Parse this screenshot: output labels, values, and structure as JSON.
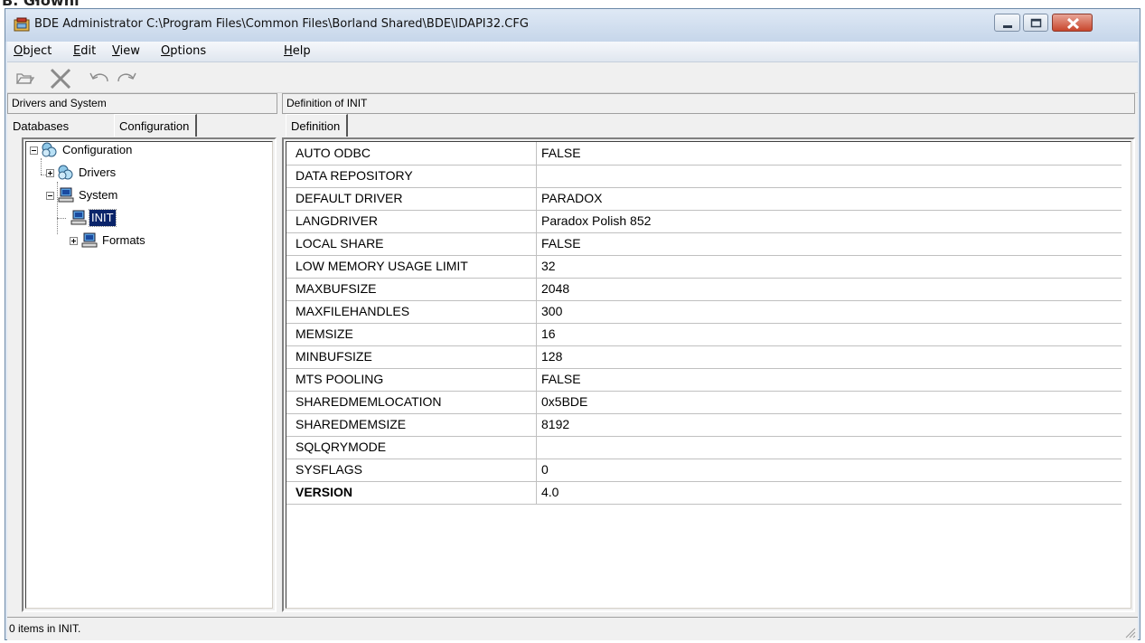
{
  "window": {
    "title": "BDE Administrator  C:\\Program Files\\Common Files\\Borland Shared\\BDE\\IDAPI32.CFG",
    "colors": {
      "titlebar": "#c6d6ea",
      "selection": "#0a246a",
      "close_button": "#c8462c"
    }
  },
  "menu": [
    "Object",
    "Edit",
    "View",
    "Options",
    "Help"
  ],
  "toolbar": {
    "buttons": [
      "open-icon",
      "delete-icon",
      "undo-icon",
      "redo-icon"
    ]
  },
  "left_header": "Drivers and System",
  "right_header": "Definition of INIT",
  "left_tabs": [
    "Databases",
    "Configuration"
  ],
  "right_tabs": [
    "Definition"
  ],
  "tree": [
    {
      "label": "Configuration",
      "icon": "database-cluster-icon",
      "expanded": true
    },
    {
      "label": "Drivers",
      "icon": "database-cluster-icon",
      "expanded": false
    },
    {
      "label": "System",
      "icon": "computer-icon",
      "expanded": true
    },
    {
      "label": "INIT",
      "icon": "computer-icon",
      "selected": true
    },
    {
      "label": "Formats",
      "icon": "computer-icon",
      "expanded": false
    }
  ],
  "definition": [
    {
      "key": "AUTO ODBC",
      "value": "FALSE"
    },
    {
      "key": "DATA REPOSITORY",
      "value": ""
    },
    {
      "key": "DEFAULT DRIVER",
      "value": "PARADOX"
    },
    {
      "key": "LANGDRIVER",
      "value": "Paradox Polish 852"
    },
    {
      "key": "LOCAL SHARE",
      "value": "FALSE"
    },
    {
      "key": "LOW MEMORY USAGE LIMIT",
      "value": "32"
    },
    {
      "key": "MAXBUFSIZE",
      "value": "2048"
    },
    {
      "key": "MAXFILEHANDLES",
      "value": "300"
    },
    {
      "key": "MEMSIZE",
      "value": "16"
    },
    {
      "key": "MINBUFSIZE",
      "value": "128"
    },
    {
      "key": "MTS POOLING",
      "value": "FALSE"
    },
    {
      "key": "SHAREDMEMLOCATION",
      "value": "0x5BDE"
    },
    {
      "key": "SHAREDMEMSIZE",
      "value": "8192"
    },
    {
      "key": "SQLQRYMODE",
      "value": ""
    },
    {
      "key": "SYSFLAGS",
      "value": "0"
    },
    {
      "key": "VERSION",
      "value": "4.0",
      "bold": true
    }
  ],
  "status": "0 items in INIT."
}
